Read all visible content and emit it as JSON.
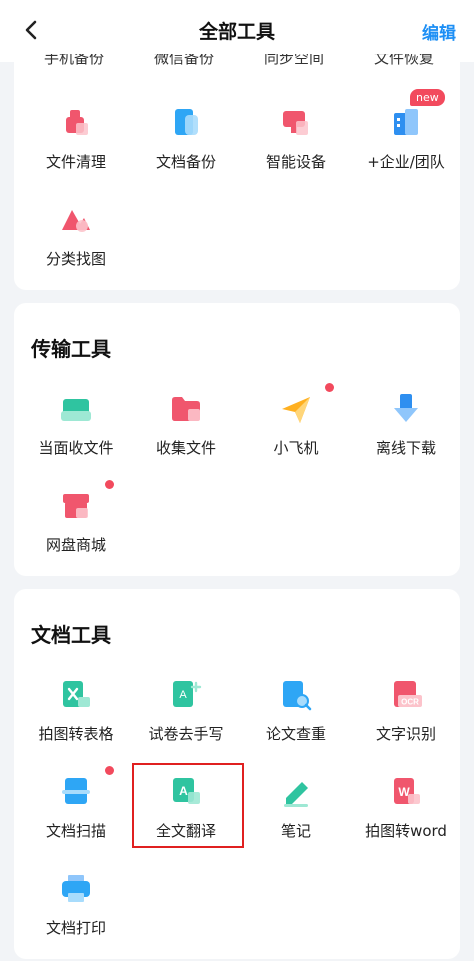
{
  "header": {
    "title": "全部工具",
    "edit_label": "编辑"
  },
  "partial_row": [
    "手机备份",
    "微信备份",
    "同步空间",
    "文件恢复"
  ],
  "section1": {
    "items": [
      {
        "label": "文件清理",
        "icon": "trash-icon"
      },
      {
        "label": "文档备份",
        "icon": "document-backup-icon"
      },
      {
        "label": "智能设备",
        "icon": "monitor-icon"
      },
      {
        "label": "+企业/团队",
        "icon": "enterprise-icon",
        "badge": "new"
      },
      {
        "label": "分类找图",
        "icon": "image-search-icon"
      }
    ]
  },
  "transfer": {
    "title": "传输工具",
    "items": [
      {
        "label": "当面收文件",
        "icon": "inbox-icon"
      },
      {
        "label": "收集文件",
        "icon": "folder-icon"
      },
      {
        "label": "小飞机",
        "icon": "paper-plane-icon",
        "dot": true
      },
      {
        "label": "离线下载",
        "icon": "download-icon"
      },
      {
        "label": "网盘商城",
        "icon": "store-icon",
        "dot": true
      }
    ]
  },
  "doc": {
    "title": "文档工具",
    "items": [
      {
        "label": "拍图转表格",
        "icon": "photo-to-sheet-icon"
      },
      {
        "label": "试卷去手写",
        "icon": "remove-handwriting-icon"
      },
      {
        "label": "论文查重",
        "icon": "paper-check-icon"
      },
      {
        "label": "文字识别",
        "icon": "ocr-icon",
        "icon_text": "OCR"
      },
      {
        "label": "文档扫描",
        "icon": "scan-icon",
        "dot": true
      },
      {
        "label": "全文翻译",
        "icon": "translate-icon",
        "icon_text": "A"
      },
      {
        "label": "笔记",
        "icon": "note-pen-icon"
      },
      {
        "label": "拍图转word",
        "icon": "photo-to-word-icon",
        "icon_text": "W"
      },
      {
        "label": "文档打印",
        "icon": "printer-icon"
      }
    ]
  },
  "colors": {
    "accent": "#1d8ff5",
    "highlight": "#e02020",
    "badge": "#f24a5d"
  }
}
